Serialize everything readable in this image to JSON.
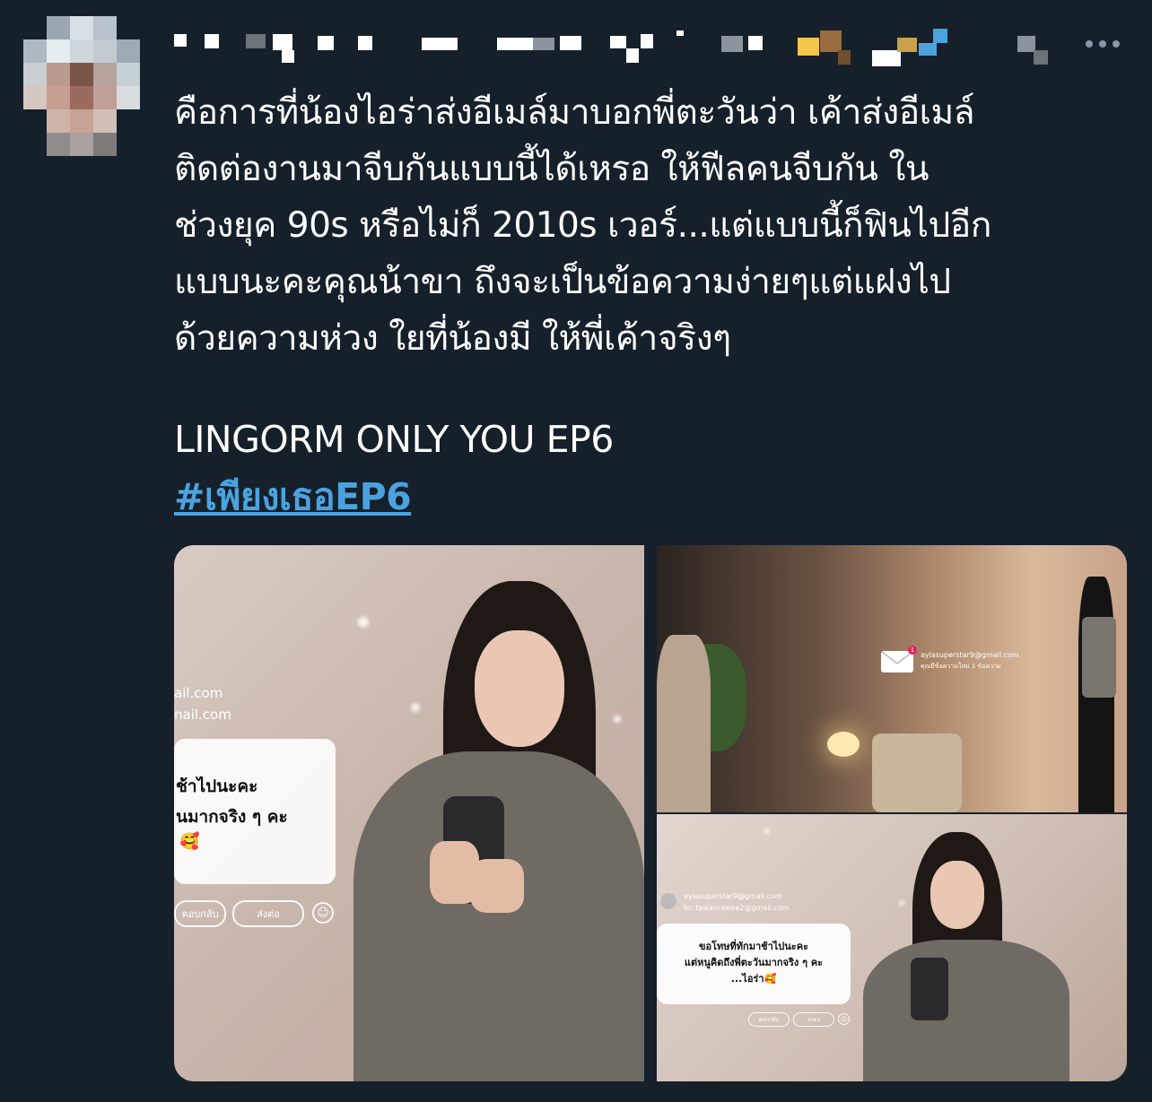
{
  "tweet": {
    "body": "คือการที่น้องไอร่าส่งอีเมล์มาบอกพี่ตะวันว่า เค้าส่งอีเมล์\nติดต่องานมาจีบกันแบบนี้ได้เหรอ ให้ฟีลคนจีบกัน ใน\nช่วงยุค 90s หรือไม่ก็ 2010s เวอร์...แต่แบบนี้ก็ฟินไปอีก\nแบบนะคะคุณน้าขา ถึงจะเป็นข้อความง่ายๆแต่แฝงไป\nด้วยความห่วง ใยที่น้องมี ให้พี่เค้าจริงๆ",
    "title": "LINGORM ONLY YOU EP6",
    "hashtag": "#เพียงเธอEP6"
  },
  "icons": {
    "more": "more-horizontal-icon",
    "mail": "mail-envelope-icon",
    "emoji": "smiley-icon"
  },
  "media": {
    "photo1": {
      "email_partial_1": "ail.com",
      "email_partial_2": "nail.com",
      "msg_line1": "ช้าไปนะคะ",
      "msg_line2": "นมากจริง ๆ คะ",
      "msg_emoji": "🥰",
      "reply_label": "ตอบกลับ",
      "forward_label": "ส่งต่อ"
    },
    "photo2": {
      "email": "aylasuperstar9@gmail.com",
      "subtitle": "คุณมีข้อความใหม่ 1 ข้อความ",
      "badge": "1"
    },
    "photo3": {
      "from": "aylasuperstar9@gmail.com",
      "to": "to: tawanrawee2@gmail.com",
      "msg_line1": "ขอโทษที่ทักมาช้าไปนะคะ",
      "msg_line2": "แต่หนูคิดถึงพี่ตะวันมากจริง ๆ คะ",
      "msg_line3": "...ไอร่า🥰",
      "reply_label": "ตอบกลับ",
      "forward_label": "ส่งต่อ"
    }
  }
}
